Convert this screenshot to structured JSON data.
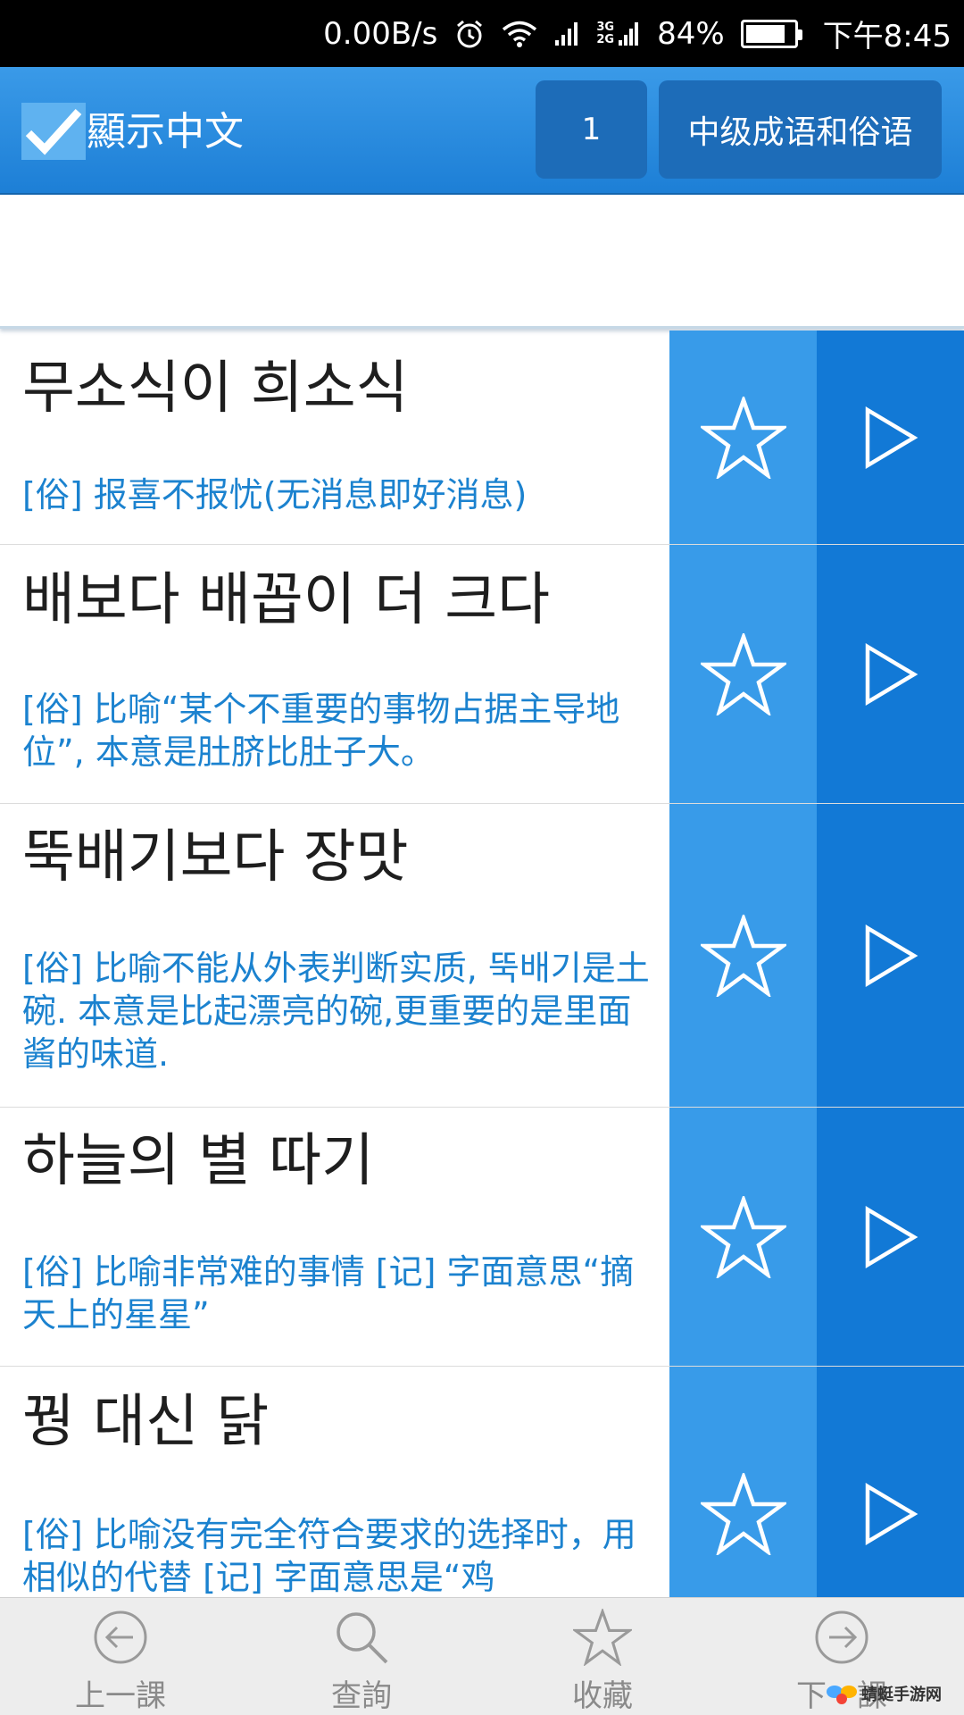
{
  "status_bar": {
    "speed": "0.00B/s",
    "net_top": "3G",
    "net_bottom": "2G",
    "battery": "84%",
    "battery_level": 0.84,
    "time": "下午8:45"
  },
  "toolbar": {
    "show_chinese_label": "顯示中文",
    "show_chinese_checked": true,
    "lesson_number": "1",
    "category": "中级成语和俗语"
  },
  "entries": [
    {
      "korean": "무소식이 희소식",
      "meaning": "[俗] 报喜不报忧(无消息即好消息)"
    },
    {
      "korean": "배보다 배꼽이 더 크다",
      "meaning": "[俗] 比喻“某个不重要的事物占据主导地位”, 本意是肚脐比肚子大。"
    },
    {
      "korean": "뚝배기보다 장맛",
      "meaning": "[俗] 比喻不能从外表判断实质, 뚝배기是土碗. 本意是比起漂亮的碗,更重要的是里面酱的味道."
    },
    {
      "korean": "하늘의 별 따기",
      "meaning": "[俗] 比喻非常难的事情 [记] 字面意思“摘天上的星星”"
    },
    {
      "korean": "꿩 대신 닭",
      "meaning": "[俗] 比喻没有完全符合要求的选择时，用相似的代替 [记] 字面意思是“鸡"
    }
  ],
  "bottom_nav": {
    "prev_label": "上一課",
    "search_label": "查詢",
    "favorites_label": "收藏",
    "next_label": "下一課"
  },
  "watermark": {
    "name": "蜻蜓手游网",
    "url": "www.QT6.com"
  },
  "colors": {
    "toolbar": "#2b8de0",
    "favorite_column": "#389be9",
    "play_column": "#1279d6",
    "meaning_text": "#1b82cf"
  },
  "icons": [
    "alarm-icon",
    "wifi-icon",
    "signal-icon",
    "battery-icon",
    "checkmark-icon",
    "star-outline-icon",
    "play-outline-icon",
    "arrow-left-circle-icon",
    "search-icon",
    "arrow-right-circle-icon"
  ]
}
